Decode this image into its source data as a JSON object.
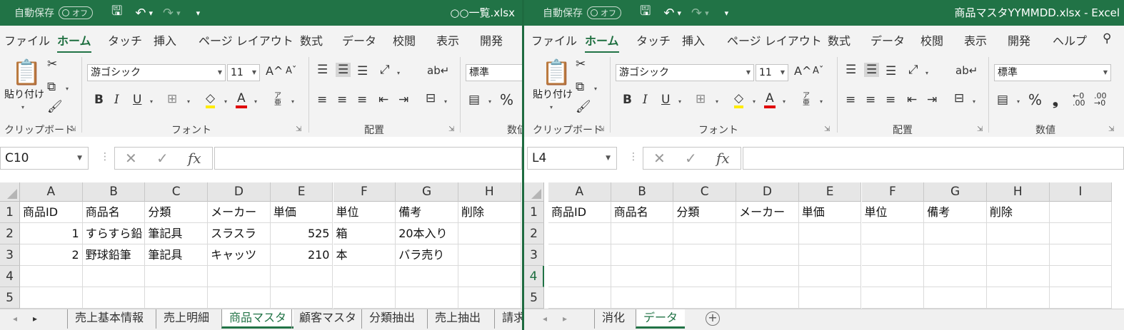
{
  "left": {
    "autosave_label": "自動保存",
    "autosave_state": "オフ",
    "file_title": "○○一覧.xlsx",
    "tabs": [
      "ファイル",
      "ホーム",
      "タッチ",
      "挿入",
      "ページ レイアウト",
      "数式",
      "データ",
      "校閲",
      "表示",
      "開発"
    ],
    "active_tab": "ホーム",
    "ribbon": {
      "paste_label": "貼り付け",
      "clipboard_label": "クリップボード",
      "font_name": "游ゴシック",
      "font_size": "11",
      "font_group_label": "フォント",
      "align_group_label": "配置",
      "number_format": "標準",
      "number_group_label": "数値",
      "bold": "B",
      "italic": "I",
      "underline": "U",
      "percent": "%",
      "grow_font": "A",
      "shrink_font": "A",
      "font_color_glyph": "A",
      "phonetic": "ア亜"
    },
    "name_box": "C10",
    "columns": [
      "A",
      "B",
      "C",
      "D",
      "E",
      "F",
      "G",
      "H"
    ],
    "rows": [
      "1",
      "2",
      "3",
      "4",
      "5"
    ],
    "cells": [
      [
        "商品ID",
        "商品名",
        "分類",
        "メーカー",
        "単価",
        "単位",
        "備考",
        "削除"
      ],
      [
        "1",
        "すらすら鉛",
        "筆記具",
        "スラスラ",
        "525",
        "箱",
        "20本入り",
        ""
      ],
      [
        "2",
        "野球鉛筆",
        "筆記具",
        "キャッツ",
        "210",
        "本",
        "バラ売り",
        ""
      ],
      [
        "",
        "",
        "",
        "",
        "",
        "",
        "",
        ""
      ],
      [
        "",
        "",
        "",
        "",
        "",
        "",
        "",
        ""
      ]
    ],
    "sheets": [
      "売上基本情報",
      "売上明細",
      "商品マスタ",
      "顧客マスタ",
      "分類抽出",
      "売上抽出",
      "請求"
    ],
    "active_sheet": "商品マスタ"
  },
  "right": {
    "autosave_label": "自動保存",
    "autosave_state": "オフ",
    "file_title": "商品マスタYYMMDD.xlsx - Excel",
    "tabs": [
      "ファイル",
      "ホーム",
      "タッチ",
      "挿入",
      "ページ レイアウト",
      "数式",
      "データ",
      "校閲",
      "表示",
      "開発",
      "ヘルプ"
    ],
    "active_tab": "ホーム",
    "ribbon": {
      "paste_label": "貼り付け",
      "clipboard_label": "クリップボード",
      "font_name": "游ゴシック",
      "font_size": "11",
      "font_group_label": "フォント",
      "align_group_label": "配置",
      "number_format": "標準",
      "number_group_label": "数値",
      "bold": "B",
      "italic": "I",
      "underline": "U",
      "percent": "%",
      "grow_font": "A",
      "shrink_font": "A",
      "font_color_glyph": "A",
      "phonetic": "ア亜"
    },
    "name_box": "L4",
    "columns": [
      "A",
      "B",
      "C",
      "D",
      "E",
      "F",
      "G",
      "H",
      "I"
    ],
    "rows": [
      "1",
      "2",
      "3",
      "4",
      "5"
    ],
    "active_row": "4",
    "cells": [
      [
        "商品ID",
        "商品名",
        "分類",
        "メーカー",
        "単価",
        "単位",
        "備考",
        "削除",
        ""
      ],
      [
        "",
        "",
        "",
        "",
        "",
        "",
        "",
        "",
        ""
      ],
      [
        "",
        "",
        "",
        "",
        "",
        "",
        "",
        "",
        ""
      ],
      [
        "",
        "",
        "",
        "",
        "",
        "",
        "",
        "",
        ""
      ],
      [
        "",
        "",
        "",
        "",
        "",
        "",
        "",
        "",
        ""
      ]
    ],
    "sheets": [
      "消化",
      "データ"
    ],
    "active_sheet": "データ"
  },
  "colors": {
    "excel_green": "#217346",
    "ribbon_bg": "#f3f3f3",
    "header_bg": "#e6e6e6"
  },
  "icons": [
    "save-icon",
    "undo-icon",
    "redo-icon",
    "customize-qat-icon",
    "paste-icon",
    "cut-icon",
    "copy-icon",
    "format-painter-icon",
    "border-icon",
    "fill-color-icon",
    "font-color-icon",
    "align-top-icon",
    "align-middle-icon",
    "align-bottom-icon",
    "orientation-icon",
    "wrap-text-icon",
    "align-left-icon",
    "center-icon",
    "align-right-icon",
    "decrease-indent-icon",
    "increase-indent-icon",
    "merge-icon",
    "accounting-format-icon",
    "comma-style-icon",
    "increase-decimal-icon",
    "decrease-decimal-icon",
    "cancel-icon",
    "enter-icon",
    "function-icon",
    "search-icon",
    "add-sheet-icon"
  ]
}
